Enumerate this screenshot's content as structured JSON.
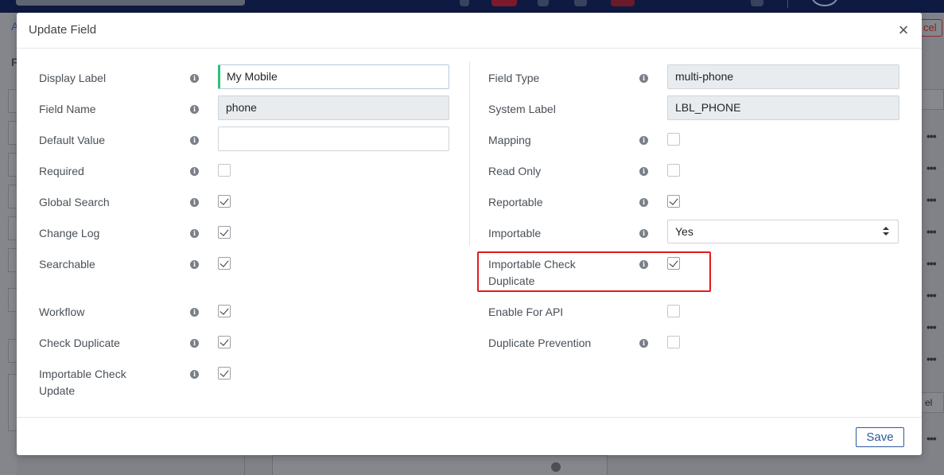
{
  "background": {
    "left_link": "A",
    "left_heading": "F",
    "cancel_fragment": "cel",
    "select_fragment": "el",
    "row_menu": "•••"
  },
  "modal": {
    "title": "Update Field",
    "close_label": "×",
    "save_label": "Save",
    "left_fields": [
      {
        "label": "Display Label",
        "kind": "input",
        "value": "My Mobile",
        "state": "focused"
      },
      {
        "label": "Field Name",
        "kind": "input",
        "value": "phone",
        "state": "readonly"
      },
      {
        "label": "Default Value",
        "kind": "input",
        "value": "",
        "state": "editable"
      },
      {
        "label": "Required",
        "kind": "checkbox",
        "checked": false
      },
      {
        "label": "Global Search",
        "kind": "checkbox",
        "checked": true
      },
      {
        "label": "Change Log",
        "kind": "checkbox",
        "checked": true
      },
      {
        "label": "Searchable",
        "kind": "checkbox",
        "checked": true
      },
      {
        "label": "Workflow",
        "kind": "checkbox",
        "checked": true
      },
      {
        "label": "Check Duplicate",
        "kind": "checkbox",
        "checked": true
      },
      {
        "label_line1": "Importable Check",
        "label_line2": "Update",
        "kind": "checkbox",
        "checked": true
      }
    ],
    "right_fields": [
      {
        "label": "Field Type",
        "kind": "input",
        "value": "multi-phone",
        "state": "readonly"
      },
      {
        "label": "System Label",
        "kind": "input",
        "value": "LBL_PHONE",
        "state": "readonly"
      },
      {
        "label": "Mapping",
        "kind": "checkbox",
        "checked": false
      },
      {
        "label": "Read Only",
        "kind": "checkbox",
        "checked": false
      },
      {
        "label": "Reportable",
        "kind": "checkbox",
        "checked": true
      },
      {
        "label": "Importable",
        "kind": "select",
        "value": "Yes"
      },
      {
        "label_line1": "Importable Check",
        "label_line2": "Duplicate",
        "kind": "checkbox",
        "checked": true,
        "highlighted": true
      },
      {
        "label": "Enable For API",
        "kind": "checkbox",
        "checked": false
      },
      {
        "label": "Duplicate Prevention",
        "kind": "checkbox",
        "checked": false
      }
    ]
  },
  "icons": {
    "info": "info-icon",
    "close": "close-icon",
    "select_arrows": "sort-arrows-icon"
  },
  "colors": {
    "save_border": "#2c5aa0",
    "highlight": "#e21b1b",
    "focus_accent": "#2fbf7a"
  }
}
